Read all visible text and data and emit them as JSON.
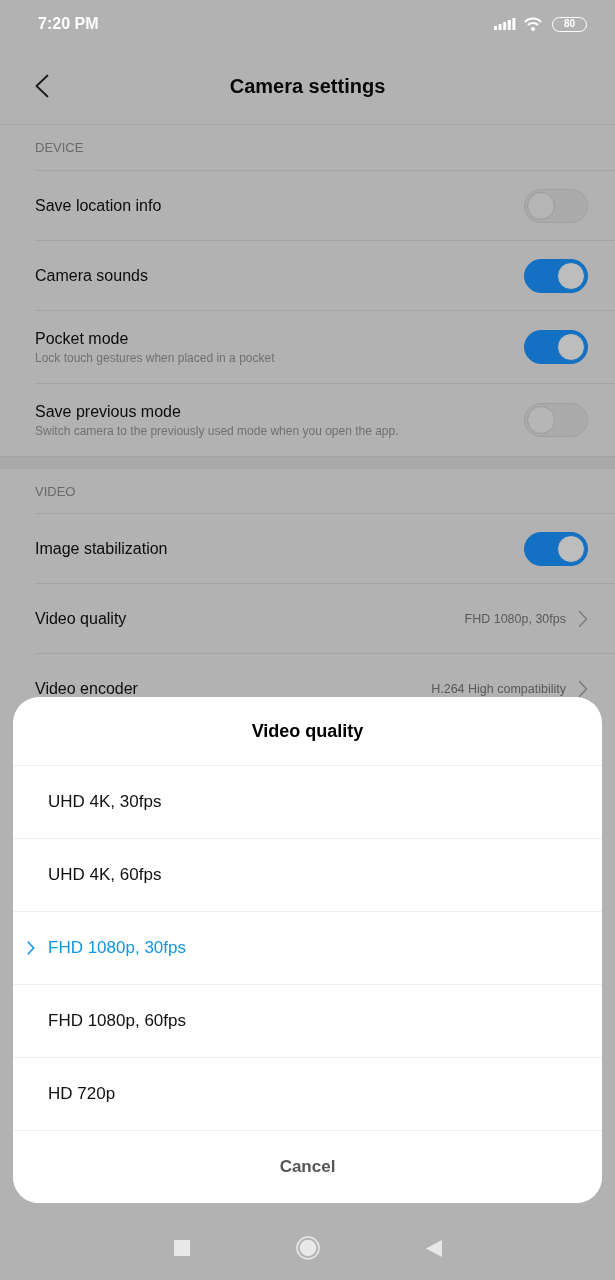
{
  "status_bar": {
    "time": "7:20 PM",
    "battery": "80"
  },
  "header": {
    "title": "Camera settings"
  },
  "sections": [
    {
      "label": "DEVICE",
      "items": [
        {
          "kind": "toggle",
          "title": "Save location info",
          "on": false
        },
        {
          "kind": "toggle",
          "title": "Camera sounds",
          "on": true
        },
        {
          "kind": "toggle",
          "title": "Pocket mode",
          "subtitle": "Lock touch gestures when placed in a pocket",
          "on": true
        },
        {
          "kind": "toggle",
          "title": "Save previous mode",
          "subtitle": "Switch camera to the previously used mode when you open the app.",
          "on": false
        }
      ]
    },
    {
      "label": "VIDEO",
      "items": [
        {
          "kind": "toggle",
          "title": "Image stabilization",
          "on": true
        },
        {
          "kind": "link",
          "title": "Video quality",
          "value": "FHD 1080p, 30fps"
        },
        {
          "kind": "link",
          "title": "Video encoder",
          "value": "H.264 High compatibility"
        }
      ]
    }
  ],
  "dialog": {
    "title": "Video quality",
    "options": [
      {
        "label": "UHD 4K, 30fps",
        "selected": false
      },
      {
        "label": "UHD 4K, 60fps",
        "selected": false
      },
      {
        "label": "FHD 1080p, 30fps",
        "selected": true
      },
      {
        "label": "FHD 1080p, 60fps",
        "selected": false
      },
      {
        "label": "HD 720p",
        "selected": false
      }
    ],
    "cancel": "Cancel"
  }
}
